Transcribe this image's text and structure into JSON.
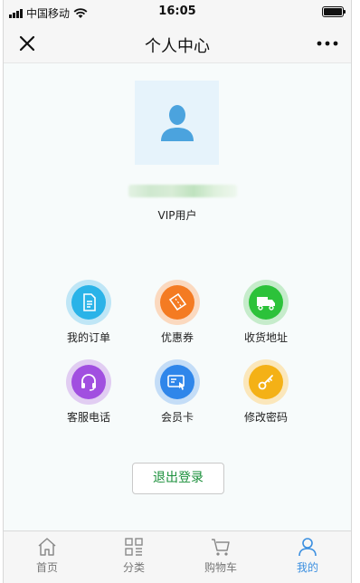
{
  "status_bar": {
    "carrier": "中国移动",
    "time": "16:05"
  },
  "nav": {
    "title": "个人中心"
  },
  "profile": {
    "vip_label": "VIP用户"
  },
  "features": [
    {
      "label": "我的订单",
      "icon": "order-icon",
      "ring": "#bfe6f6",
      "color": "#2ab3e8"
    },
    {
      "label": "优惠券",
      "icon": "coupon-icon",
      "ring": "#fbd9bf",
      "color": "#f47b22"
    },
    {
      "label": "收货地址",
      "icon": "truck-icon",
      "ring": "#c6eccb",
      "color": "#2cc23a"
    },
    {
      "label": "客服电话",
      "icon": "headset-icon",
      "ring": "#e1cdf2",
      "color": "#a14fe0"
    },
    {
      "label": "会员卡",
      "icon": "member-card-icon",
      "ring": "#c4ddf7",
      "color": "#2f86ea"
    },
    {
      "label": "修改密码",
      "icon": "key-icon",
      "ring": "#fbe7bb",
      "color": "#f4b116"
    }
  ],
  "logout": {
    "label": "退出登录"
  },
  "tabs": [
    {
      "label": "首页",
      "icon": "home-icon",
      "active": false
    },
    {
      "label": "分类",
      "icon": "category-icon",
      "active": false
    },
    {
      "label": "购物车",
      "icon": "cart-icon",
      "active": false
    },
    {
      "label": "我的",
      "icon": "user-icon",
      "active": true
    }
  ],
  "colors": {
    "accent": "#3b8fe0",
    "logout_text": "#1a8f3a",
    "background": "#f7fbfb"
  }
}
